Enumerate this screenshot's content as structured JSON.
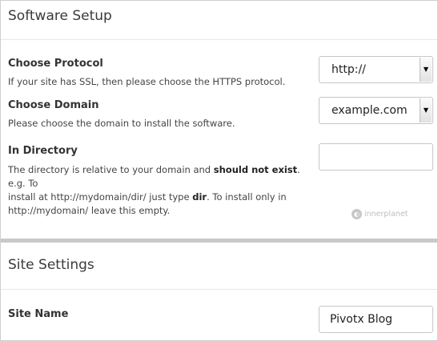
{
  "software_setup": {
    "title": "Software Setup",
    "protocol": {
      "label": "Choose Protocol",
      "help": "If your site has SSL, then please choose the HTTPS protocol.",
      "value": "http://"
    },
    "domain": {
      "label": "Choose Domain",
      "help": "Please choose the domain to install the software.",
      "value": "example.com"
    },
    "directory": {
      "label": "In Directory",
      "help_line1_a": "The directory is relative to your domain and ",
      "help_line1_b": "should not exist",
      "help_line1_c": ". e.g. To",
      "help_line2_a": "install at http://mydomain/dir/ just type ",
      "help_line2_b": "dir",
      "help_line2_c": ". To install only in",
      "help_line3": "http://mydomain/ leave this empty.",
      "value": ""
    },
    "logo_text": "innerplanet"
  },
  "site_settings": {
    "title": "Site Settings",
    "site_name": {
      "label": "Site Name",
      "value": "Pivotx Blog"
    }
  }
}
